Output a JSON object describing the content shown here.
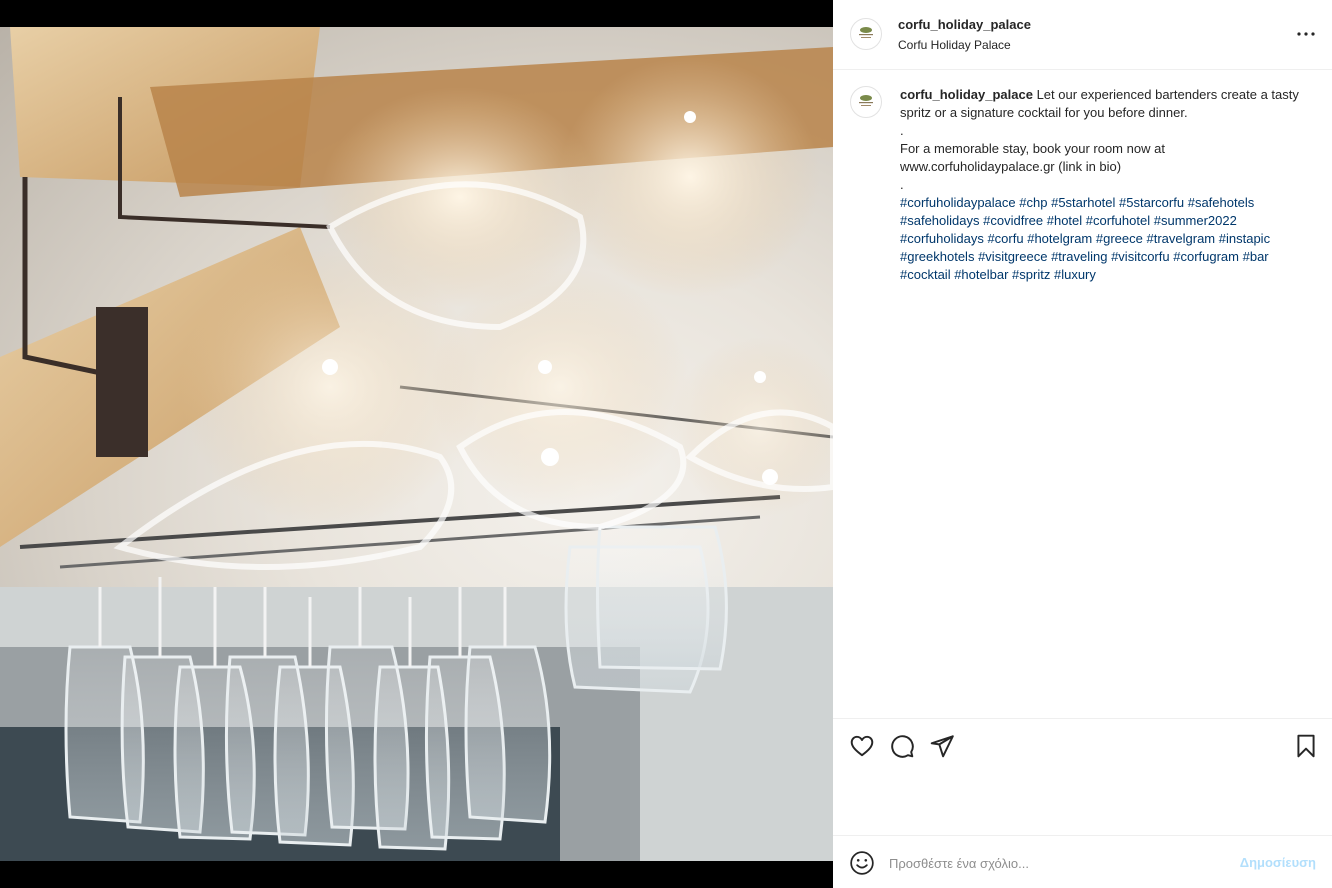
{
  "post": {
    "username": "corfu_holiday_palace",
    "location": "Corfu Holiday Palace"
  },
  "caption": {
    "username": "corfu_holiday_palace",
    "text_line1": " Let our experienced bartenders create a tasty spritz or a signature cocktail for you before dinner.",
    "dot1": ".",
    "text_line2": "For a memorable stay, book your room now at www.corfuholidaypalace.gr (link in bio)",
    "dot2": ".",
    "hashtags": [
      "#corfuholidaypalace",
      "#chp",
      "#5starhotel",
      "#5starcorfu",
      "#safehotels",
      "#safeholidays",
      "#covidfree",
      "#hotel",
      "#corfuhotel",
      "#summer2022",
      "#corfuholidays",
      "#corfu",
      "#hotelgram",
      "#greece",
      "#travelgram",
      "#instapic",
      "#greekhotels",
      "#visitgreece",
      "#traveling",
      "#visitcorfu",
      "#corfugram",
      "#bar",
      "#cocktail",
      "#hotelbar",
      "#spritz",
      "#luxury"
    ]
  },
  "comment": {
    "placeholder": "Προσθέστε ένα σχόλιο...",
    "post_label": "Δημοσίευση"
  },
  "icons": {
    "like": "heart-icon",
    "comment": "comment-icon",
    "share": "paper-plane-icon",
    "save": "bookmark-icon",
    "more": "more-horizontal-icon",
    "emoji": "emoji-icon"
  },
  "colors": {
    "hashtag": "#00376b",
    "post_button": "#b2dffc",
    "border": "#efefef"
  }
}
